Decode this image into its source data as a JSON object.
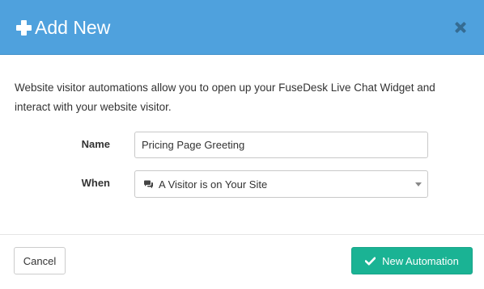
{
  "modal": {
    "title": "Add New",
    "close_label": "×"
  },
  "description": "Website visitor automations allow you to open up your FuseDesk Live Chat Widget and interact with your website visitor.",
  "form": {
    "name_label": "Name",
    "name_value": "Pricing Page Greeting",
    "when_label": "When",
    "when_value": "A Visitor is on Your Site"
  },
  "footer": {
    "cancel_label": "Cancel",
    "submit_label": "New Automation"
  },
  "icons": {
    "header": "plus-icon",
    "close": "close-icon",
    "when_option": "comments-icon",
    "select_caret": "caret-down-icon",
    "submit": "check-icon"
  },
  "colors": {
    "header_bg": "#4fa1dd",
    "primary_button": "#1ab394",
    "close_icon": "#356c93"
  }
}
